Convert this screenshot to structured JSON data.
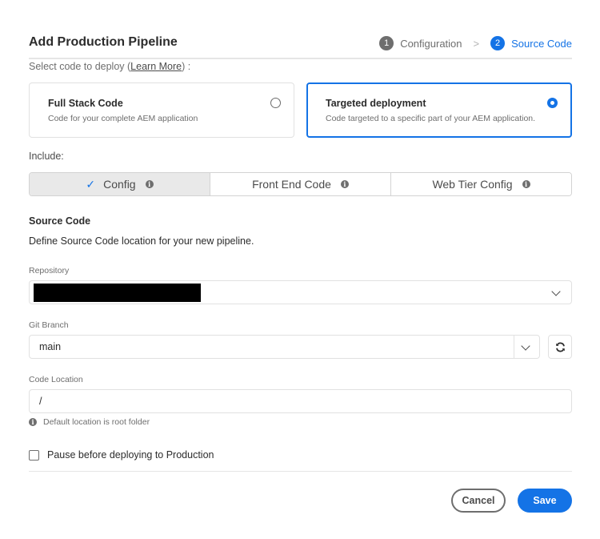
{
  "header": {
    "title": "Add Production Pipeline",
    "steps": [
      {
        "number": "1",
        "label": "Configuration",
        "state": "done"
      },
      {
        "number": "2",
        "label": "Source Code",
        "state": "active"
      }
    ],
    "step_separator": ">"
  },
  "deploy_prompt": {
    "prefix": "Select code to deploy (",
    "link": "Learn More",
    "suffix": ") :"
  },
  "deploy_options": [
    {
      "title": "Full Stack Code",
      "description": "Code for your complete AEM application",
      "selected": false
    },
    {
      "title": "Targeted deployment",
      "description": "Code targeted to a specific part of your AEM application.",
      "selected": true
    }
  ],
  "include": {
    "label": "Include:",
    "options": [
      {
        "label": "Config",
        "selected": true,
        "info_icon": "i"
      },
      {
        "label": "Front End Code",
        "selected": false,
        "info_icon": "i"
      },
      {
        "label": "Web Tier Config",
        "selected": false,
        "info_icon": "i"
      }
    ],
    "check_glyph": "✓"
  },
  "source_code": {
    "heading": "Source Code",
    "description": "Define Source Code location for your new pipeline.",
    "repository": {
      "label": "Repository",
      "value": "[redacted]"
    },
    "git_branch": {
      "label": "Git Branch",
      "value": "main"
    },
    "code_location": {
      "label": "Code Location",
      "value": "/",
      "hint": "Default location is root folder",
      "hint_icon": "i"
    }
  },
  "pause": {
    "label": "Pause before deploying to Production",
    "checked": false
  },
  "actions": {
    "cancel": "Cancel",
    "save": "Save"
  },
  "colors": {
    "accent": "#1473e6",
    "muted": "#6e6e6e",
    "selected_segment": "#e9e9e9"
  }
}
